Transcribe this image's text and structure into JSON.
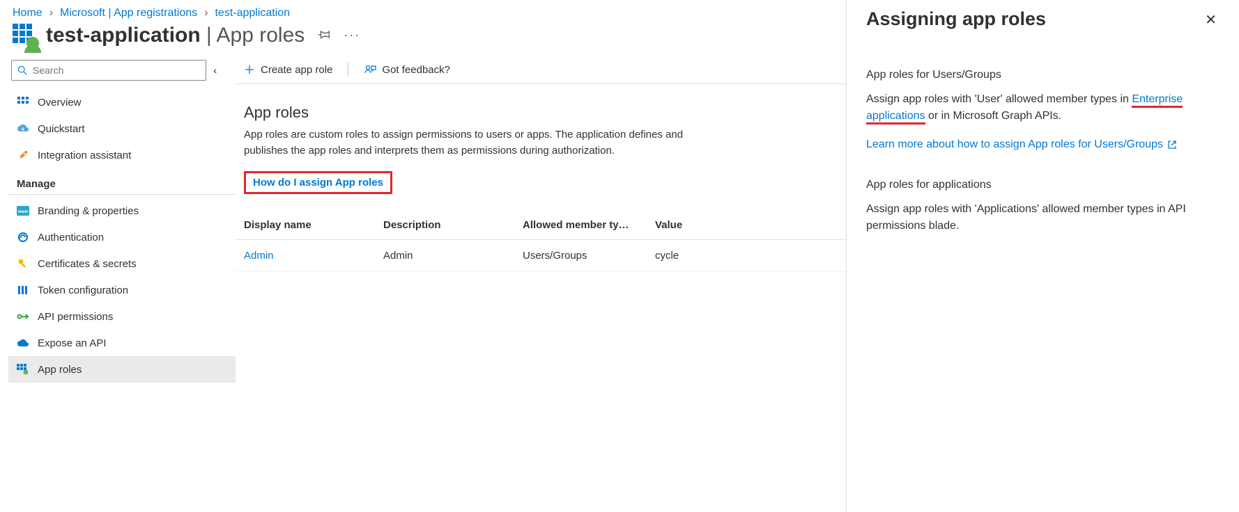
{
  "breadcrumb": [
    {
      "label": "Home"
    },
    {
      "label": "Microsoft | App registrations"
    },
    {
      "label": "test-application"
    }
  ],
  "title": {
    "app_name": "test-application",
    "suffix": " | App roles"
  },
  "search": {
    "placeholder": "Search"
  },
  "sidebar": {
    "items_top": [
      {
        "label": "Overview"
      },
      {
        "label": "Quickstart"
      },
      {
        "label": "Integration assistant"
      }
    ],
    "manage_label": "Manage",
    "items_manage": [
      {
        "label": "Branding & properties"
      },
      {
        "label": "Authentication"
      },
      {
        "label": "Certificates & secrets"
      },
      {
        "label": "Token configuration"
      },
      {
        "label": "API permissions"
      },
      {
        "label": "Expose an API"
      },
      {
        "label": "App roles"
      }
    ]
  },
  "toolbar": {
    "create_label": "Create app role",
    "feedback_label": "Got feedback?"
  },
  "content": {
    "heading": "App roles",
    "description": "App roles are custom roles to assign permissions to users or apps. The application defines and publishes the app roles and interprets them as permissions during authorization.",
    "assign_link": "How do I assign App roles",
    "columns": {
      "display_name": "Display name",
      "description": "Description",
      "allowed": "Allowed member ty…",
      "value": "Value"
    },
    "rows": [
      {
        "display_name": "Admin",
        "description": "Admin",
        "allowed": "Users/Groups",
        "value": "cycle"
      }
    ]
  },
  "panel": {
    "title": "Assigning app roles",
    "users_heading": "App roles for Users/Groups",
    "users_para_prefix": "Assign app roles with 'User' allowed member types in ",
    "users_link": "Enterprise applications",
    "users_para_suffix": " or in Microsoft Graph APIs.",
    "learn_more": "Learn more about how to assign App roles for Users/Groups",
    "apps_heading": "App roles for applications",
    "apps_para": "Assign app roles with 'Applications' allowed member types in API permissions blade."
  }
}
